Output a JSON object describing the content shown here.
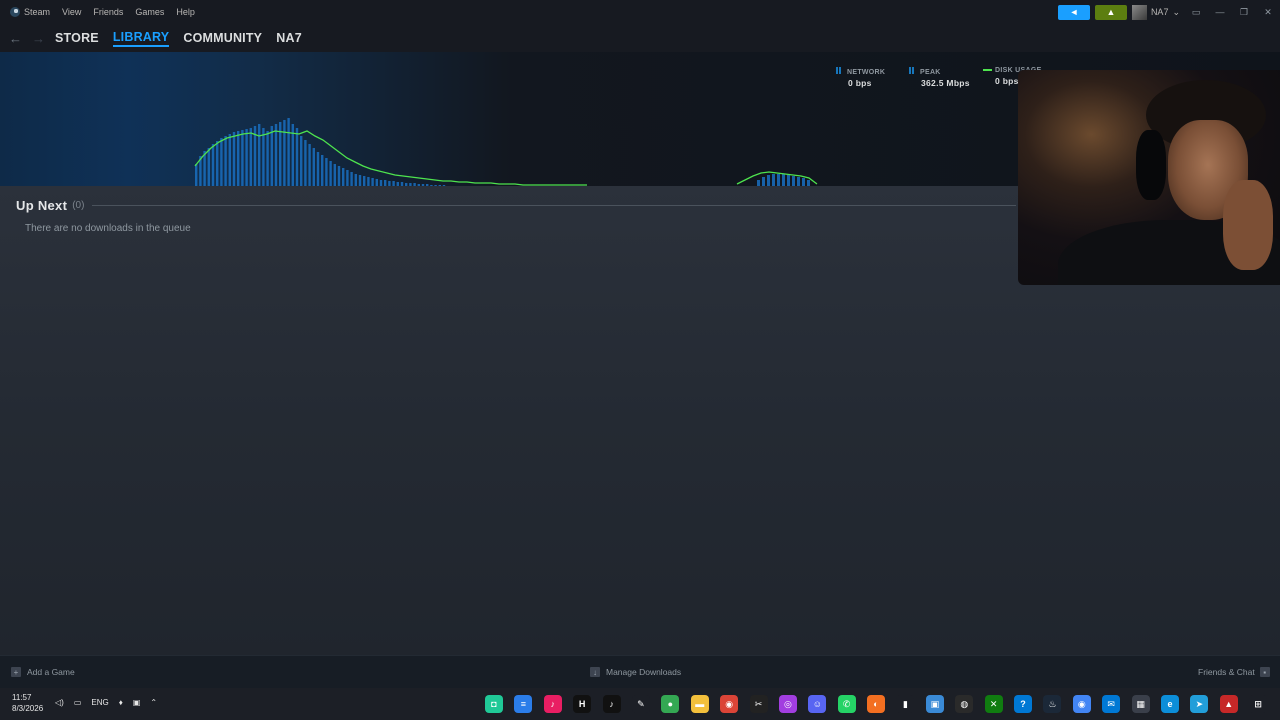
{
  "menubar": {
    "app_name": "Steam",
    "items": [
      "View",
      "Friends",
      "Games",
      "Help"
    ],
    "username": "NA7",
    "announce_icon": "megaphone-icon",
    "notify_icon": "bell-icon"
  },
  "nav": {
    "links": [
      "STORE",
      "LIBRARY",
      "COMMUNITY",
      "NA7"
    ],
    "active": "LIBRARY"
  },
  "stats": {
    "network_label": "NETWORK",
    "network_value": "0 bps",
    "peak_label": "PEAK",
    "peak_value": "362.5 Mbps",
    "disk_label": "DISK USAGE",
    "disk_value": "0 bps"
  },
  "chart_data": {
    "type": "bar",
    "series": [
      {
        "values": [
          22,
          30,
          35,
          38,
          42,
          45,
          48,
          50,
          52,
          54,
          55,
          56,
          57,
          58,
          60,
          62,
          58,
          55,
          60,
          62,
          64,
          66,
          68,
          62,
          58,
          50,
          46,
          42,
          38,
          34,
          31,
          28,
          25,
          22,
          20,
          18,
          16,
          14,
          12,
          11,
          10,
          9,
          8,
          7,
          6,
          6,
          5,
          5,
          4,
          4,
          3,
          3,
          3,
          2,
          2,
          2,
          1,
          1,
          1,
          1
        ]
      },
      {
        "values": [
          6,
          9,
          11,
          12,
          12,
          12,
          11,
          10,
          9,
          8,
          6
        ]
      }
    ],
    "line": [
      {
        "values": [
          20,
          30,
          38,
          44,
          48,
          50,
          52,
          53,
          50,
          52,
          55,
          54,
          53,
          52,
          55,
          50,
          46,
          40,
          34,
          28,
          24,
          20,
          17,
          15,
          13,
          11,
          10,
          9,
          8,
          7,
          6,
          5,
          5,
          4,
          4,
          3,
          3,
          3,
          2,
          2,
          2,
          1,
          1,
          1,
          1,
          1,
          1,
          1,
          1,
          1
        ]
      },
      {
        "values": [
          2,
          6,
          10,
          13,
          14,
          13,
          12,
          11,
          10,
          8,
          2
        ]
      }
    ],
    "colors": {
      "bars": "#1a6fbf",
      "line": "#4ee44e"
    }
  },
  "queue": {
    "title": "Up Next",
    "count": "(0)",
    "empty_message": "There are no downloads in the queue"
  },
  "bottom": {
    "add_game": "Add a Game",
    "manage_downloads": "Manage Downloads",
    "friends_chat": "Friends & Chat"
  },
  "taskbar": {
    "time": "11:57",
    "date": "8/3/2026",
    "lang": "ENG",
    "apps": [
      {
        "name": "app-green",
        "color": "#20c997",
        "glyph": "◘"
      },
      {
        "name": "app-blue",
        "color": "#2b7de9",
        "glyph": "≡"
      },
      {
        "name": "app-pink",
        "color": "#e91e63",
        "glyph": "♪"
      },
      {
        "name": "app-hbox",
        "color": "#111111",
        "glyph": "H"
      },
      {
        "name": "tiktok",
        "color": "#111111",
        "glyph": "♪"
      },
      {
        "name": "app-pen",
        "color": "#1c1f26",
        "glyph": "✎"
      },
      {
        "name": "chrome-profile",
        "color": "#34a853",
        "glyph": "●"
      },
      {
        "name": "file-explorer",
        "color": "#f3c03c",
        "glyph": "▬"
      },
      {
        "name": "chrome",
        "color": "#db4437",
        "glyph": "◉"
      },
      {
        "name": "capcut",
        "color": "#222222",
        "glyph": "✂"
      },
      {
        "name": "app-purple",
        "color": "#a23ee0",
        "glyph": "◎"
      },
      {
        "name": "discord",
        "color": "#5865f2",
        "glyph": "☺"
      },
      {
        "name": "whatsapp",
        "color": "#25d366",
        "glyph": "✆"
      },
      {
        "name": "app-orange",
        "color": "#f36f21",
        "glyph": "◐"
      },
      {
        "name": "terminal",
        "color": "#1c1f26",
        "glyph": "▮"
      },
      {
        "name": "app-screen",
        "color": "#3a8ad6",
        "glyph": "▣"
      },
      {
        "name": "obs",
        "color": "#2a2a2a",
        "glyph": "◍"
      },
      {
        "name": "xbox",
        "color": "#107c10",
        "glyph": "✕"
      },
      {
        "name": "help",
        "color": "#0078d4",
        "glyph": "?"
      },
      {
        "name": "steam",
        "color": "#1b2838",
        "glyph": "♨"
      },
      {
        "name": "chrome-2",
        "color": "#4285f4",
        "glyph": "◉"
      },
      {
        "name": "mail",
        "color": "#0078d4",
        "glyph": "✉"
      },
      {
        "name": "store",
        "color": "#3a3f4a",
        "glyph": "▦"
      },
      {
        "name": "edge",
        "color": "#0c8ed9",
        "glyph": "e"
      },
      {
        "name": "telegram",
        "color": "#229ed9",
        "glyph": "➤"
      },
      {
        "name": "app-red",
        "color": "#c62828",
        "glyph": "▲"
      },
      {
        "name": "windows",
        "color": "#1c1f26",
        "glyph": "⊞"
      }
    ]
  }
}
